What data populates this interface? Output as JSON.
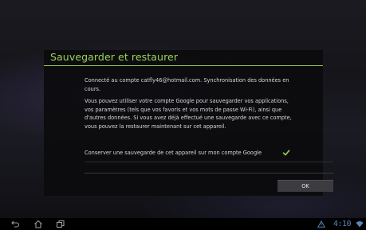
{
  "dialog": {
    "title": "Sauvegarder et restaurer",
    "paragraph_1": "Connecté au compte catfly46@hotmail.com. Synchronisation des données en cours.",
    "paragraph_2": "Vous pouvez utiliser votre compte Google pour sauvegarder vos applications, vos paramètres (tels que vos favoris et vos mots de passe Wi-Fi), ainsi que d'autres données. Si vous avez déjà effectué une sauvegarde avec ce compte, vous pouvez la restaurer maintenant sur cet appareil.",
    "backup_option": {
      "label": "Conserver une sauvegarde de cet appareil sur mon compte Google",
      "checked": true
    },
    "ok_label": "OK"
  },
  "status_bar": {
    "time": "4:10"
  },
  "nav_icons": [
    "back-icon",
    "home-icon",
    "recent-apps-icon"
  ],
  "colors": {
    "accent": "#9bd25a",
    "clock": "#5a86b8"
  }
}
